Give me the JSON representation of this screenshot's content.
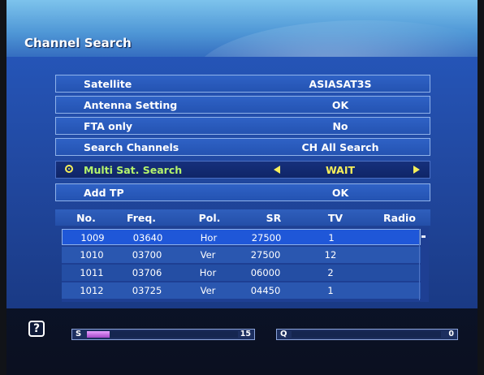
{
  "screen": {
    "title": "Channel Search"
  },
  "menu": [
    {
      "label": "Satellite",
      "value": "ASIASAT3S"
    },
    {
      "label": "Antenna Setting",
      "value": "OK"
    },
    {
      "label": "FTA only",
      "value": "No"
    },
    {
      "label": "Search Channels",
      "value": "CH All Search"
    },
    {
      "label": "Multi Sat. Search",
      "value": "WAIT"
    },
    {
      "label": "Add TP",
      "value": "OK"
    }
  ],
  "tp_table": {
    "headers": [
      "No.",
      "Freq.",
      "Pol.",
      "SR",
      "TV",
      "Radio"
    ],
    "rows": [
      {
        "no": "1009",
        "freq": "03640",
        "pol": "Hor",
        "sr": "27500",
        "tv": "1",
        "radio": ""
      },
      {
        "no": "1010",
        "freq": "03700",
        "pol": "Ver",
        "sr": "27500",
        "tv": "12",
        "radio": ""
      },
      {
        "no": "1011",
        "freq": "03706",
        "pol": "Hor",
        "sr": "06000",
        "tv": "2",
        "radio": ""
      },
      {
        "no": "1012",
        "freq": "03725",
        "pol": "Ver",
        "sr": "04450",
        "tv": "1",
        "radio": ""
      }
    ]
  },
  "footer": {
    "help_icon_text": "?",
    "signal": {
      "label": "S",
      "value_text": "15",
      "level": 0.15
    },
    "quality": {
      "label": "Q",
      "value_text": "0",
      "level": 0.0
    }
  },
  "colors": {
    "accent_yellow": "#f6ee59",
    "active_label_green": "#b4f36b",
    "signal_fill": "#c46ae6"
  },
  "icons": [
    "help-icon",
    "radio-indicator-icon",
    "left-arrow-icon",
    "right-arrow-icon"
  ]
}
